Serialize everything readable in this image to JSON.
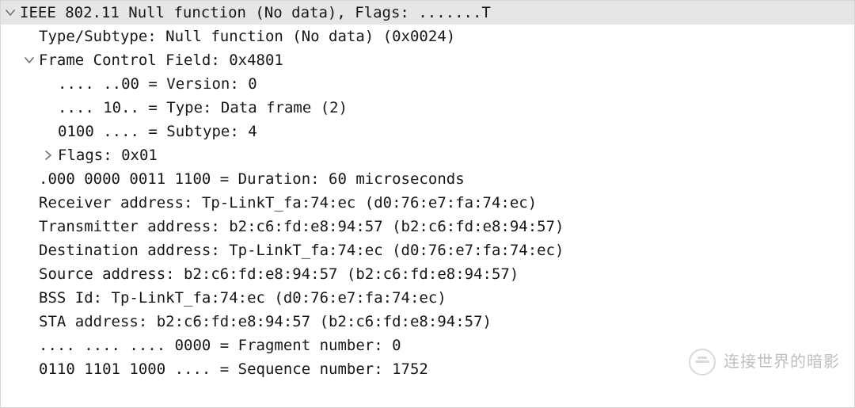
{
  "header": {
    "summary": "IEEE 802.11 Null function (No data), Flags: .......T"
  },
  "lines": {
    "type_subtype": "Type/Subtype: Null function (No data) (0x0024)",
    "frame_ctrl": "Frame Control Field: 0x4801",
    "version": ".... ..00 = Version: 0",
    "type": ".... 10.. = Type: Data frame (2)",
    "subtype": "0100 .... = Subtype: 4",
    "flags": "Flags: 0x01",
    "duration": ".000 0000 0011 1100 = Duration: 60 microseconds",
    "receiver_addr": "Receiver address: Tp-LinkT_fa:74:ec (d0:76:e7:fa:74:ec)",
    "transmitter_addr": "Transmitter address: b2:c6:fd:e8:94:57 (b2:c6:fd:e8:94:57)",
    "destination_addr": "Destination address: Tp-LinkT_fa:74:ec (d0:76:e7:fa:74:ec)",
    "source_addr": "Source address: b2:c6:fd:e8:94:57 (b2:c6:fd:e8:94:57)",
    "bss_id": "BSS Id: Tp-LinkT_fa:74:ec (d0:76:e7:fa:74:ec)",
    "sta_addr": "STA address: b2:c6:fd:e8:94:57 (b2:c6:fd:e8:94:57)",
    "fragment_num": ".... .... .... 0000 = Fragment number: 0",
    "sequence_num": "0110 1101 1000 .... = Sequence number: 1752"
  },
  "watermark": {
    "text": "连接世界的暗影"
  }
}
